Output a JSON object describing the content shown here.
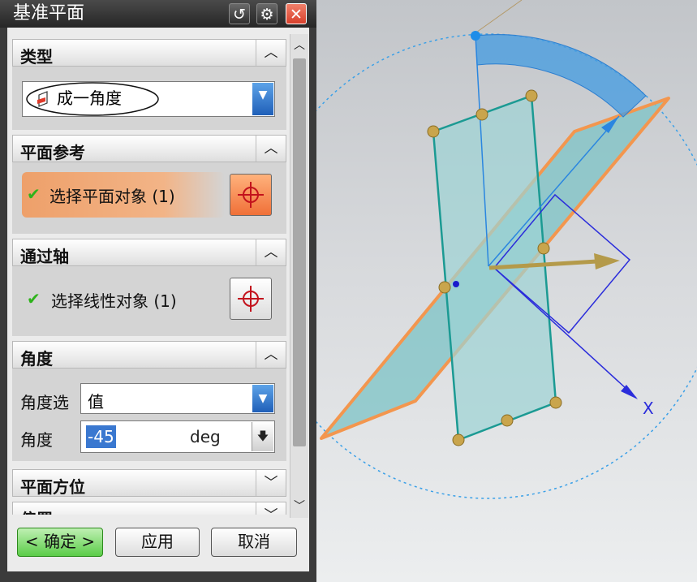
{
  "window": {
    "title": "基准平面"
  },
  "titlebar_buttons": {
    "help": "↺",
    "settings": "⚙",
    "close": "✕"
  },
  "sections": {
    "type": {
      "header": "类型",
      "selected": "成一角度",
      "icon": "plane-at-angle-icon"
    },
    "plane_ref": {
      "header": "平面参考",
      "select_text": "选择平面对象 (1)"
    },
    "through_axis": {
      "header": "通过轴",
      "select_text": "选择线性对象 (1)"
    },
    "angle": {
      "header": "角度",
      "option_label": "角度选",
      "option_value": "值",
      "angle_label": "角度",
      "angle_value": "-45",
      "unit": "deg"
    },
    "orientation": {
      "header": "平面方位"
    },
    "offset": {
      "header": "偏置"
    }
  },
  "footer": {
    "ok": "< 确定 >",
    "apply": "应用",
    "cancel": "取消"
  },
  "viewport": {
    "axis_label": "X"
  },
  "colors": {
    "accent_orange": "#f08a4b",
    "plane_fill": "#8ecfd0",
    "check_green": "#2db31a",
    "close_red": "#e15a43"
  }
}
